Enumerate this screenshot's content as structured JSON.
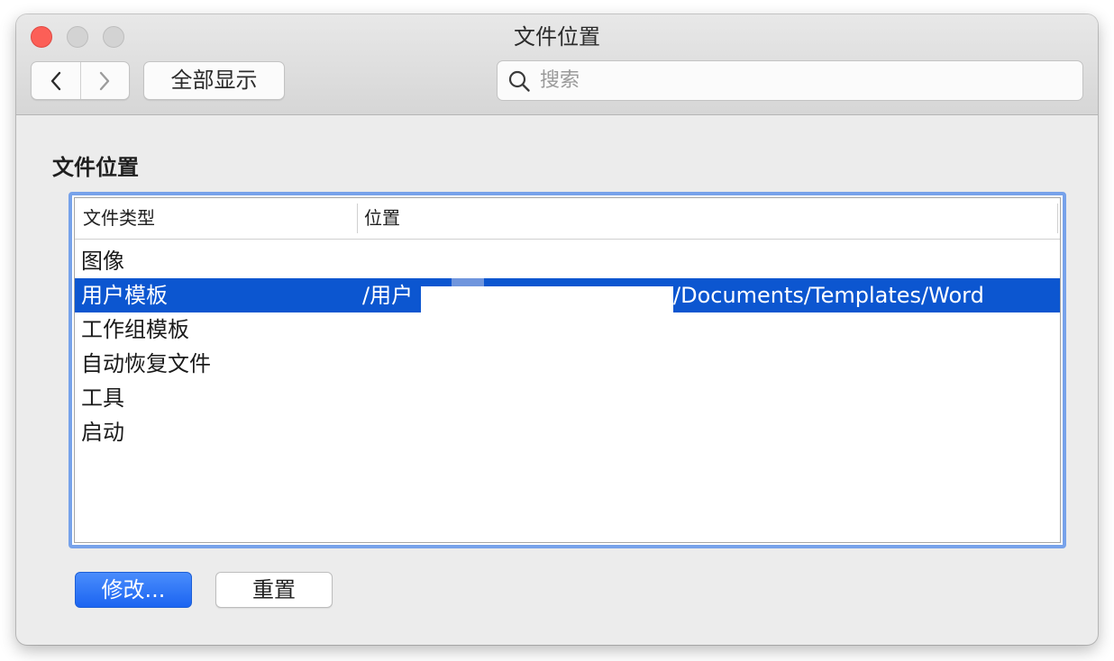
{
  "window": {
    "title": "文件位置"
  },
  "toolbar": {
    "back_icon": "chevron-left-icon",
    "forward_icon": "chevron-right-icon",
    "show_all_label": "全部显示"
  },
  "search": {
    "icon": "search-icon",
    "placeholder": "搜索"
  },
  "section": {
    "title": "文件位置"
  },
  "table": {
    "columns": [
      "文件类型",
      "位置"
    ],
    "rows": [
      {
        "type": "图像",
        "location": ""
      },
      {
        "type": "用户模板",
        "location_prefix": "/用户",
        "location_suffix": "/Documents/Templates/Word",
        "selected": true
      },
      {
        "type": "工作组模板",
        "location": ""
      },
      {
        "type": "自动恢复文件",
        "location": ""
      },
      {
        "type": "工具",
        "location": ""
      },
      {
        "type": "启动",
        "location": ""
      }
    ]
  },
  "buttons": {
    "modify_label": "修改...",
    "reset_label": "重置"
  },
  "colors": {
    "selection": "#0c56d0",
    "focus_ring": "#77a2ea",
    "close": "#fc5f57",
    "primary_button": "#1b64f1"
  }
}
